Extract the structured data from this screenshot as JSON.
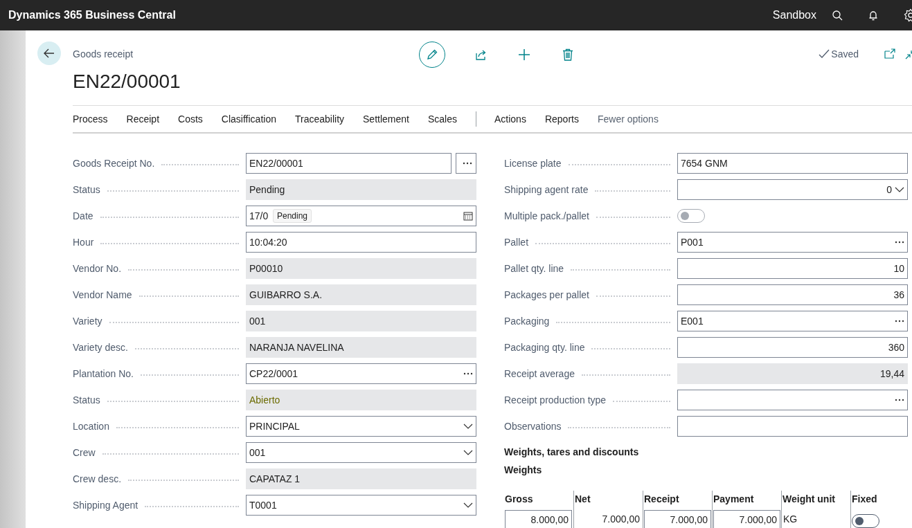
{
  "app_bar": {
    "title": "Dynamics 365 Business Central",
    "environment": "Sandbox"
  },
  "page": {
    "breadcrumb": "Goods receipt",
    "title": "EN22/00001",
    "save_status": "Saved"
  },
  "action_tab_groups": [
    {
      "tabs": [
        {
          "label": "Process",
          "kind": "tab"
        },
        {
          "label": "Receipt",
          "kind": "tab"
        },
        {
          "label": "Costs",
          "kind": "tab"
        },
        {
          "label": "Clasiffication",
          "kind": "tab"
        },
        {
          "label": "Traceability",
          "kind": "tab"
        },
        {
          "label": "Settlement",
          "kind": "tab"
        },
        {
          "label": "Scales",
          "kind": "tab"
        }
      ]
    },
    {
      "tabs": [
        {
          "label": "Actions",
          "kind": "tab"
        },
        {
          "label": "Reports",
          "kind": "tab"
        },
        {
          "label": "Fewer options",
          "kind": "toggle-link"
        }
      ]
    }
  ],
  "left_fields": [
    {
      "label": "Goods Receipt No.",
      "value": "EN22/00001",
      "kind": "assist",
      "emphasis": false
    },
    {
      "label": "Status",
      "value": "Pending",
      "kind": "readonly",
      "emphasis": false
    },
    {
      "label": "Date",
      "value": "17/0",
      "kind": "date",
      "tooltip": "Pending",
      "emphasis": false
    },
    {
      "label": "Hour",
      "value": "10:04:20",
      "kind": "text",
      "emphasis": false
    },
    {
      "label": "Vendor No.",
      "value": "P00010",
      "kind": "readonly",
      "emphasis": false
    },
    {
      "label": "Vendor Name",
      "value": "GUIBARRO S.A.",
      "kind": "readonly",
      "emphasis": false
    },
    {
      "label": "Variety",
      "value": "001",
      "kind": "readonly",
      "emphasis": false
    },
    {
      "label": "Variety desc.",
      "value": "NARANJA NAVELINA",
      "kind": "readonly",
      "emphasis": false
    },
    {
      "label": "Plantation No.",
      "value": "CP22/0001",
      "kind": "lookup",
      "emphasis": false
    },
    {
      "label": "Status",
      "value": "Abierto",
      "kind": "readonly",
      "emphasis": true
    },
    {
      "label": "Location",
      "value": "PRINCIPAL",
      "kind": "select",
      "emphasis": false
    },
    {
      "label": "Crew",
      "value": "001",
      "kind": "select",
      "emphasis": false
    },
    {
      "label": "Crew desc.",
      "value": "CAPATAZ 1",
      "kind": "readonly",
      "emphasis": false
    },
    {
      "label": "Shipping Agent",
      "value": "T0001",
      "kind": "select",
      "emphasis": false
    }
  ],
  "right_fields": [
    {
      "label": "License plate",
      "value": "7654 GNM",
      "kind": "text"
    },
    {
      "label": "Shipping agent rate",
      "value": "0",
      "kind": "number-select"
    },
    {
      "label": "Multiple pack./pallet",
      "kind": "toggle",
      "on": false
    },
    {
      "label": "Pallet",
      "value": "P001",
      "kind": "lookup"
    },
    {
      "label": "Pallet qty. line",
      "value": "10",
      "kind": "number"
    },
    {
      "label": "Packages per pallet",
      "value": "36",
      "kind": "number"
    },
    {
      "label": "Packaging",
      "value": "E001",
      "kind": "lookup"
    },
    {
      "label": "Packaging qty. line",
      "value": "360",
      "kind": "number"
    },
    {
      "label": "Receipt average",
      "value": "19,44",
      "kind": "number-readonly"
    },
    {
      "label": "Receipt production type",
      "kind": "lookup"
    },
    {
      "label": "Observations",
      "kind": "text"
    }
  ],
  "weights": {
    "heading": "Weights, tares and discounts",
    "subheading": "Weights",
    "columns": [
      "Gross",
      "Net",
      "Receipt",
      "Payment",
      "Weight unit",
      "Fixed"
    ],
    "rows": [
      {
        "cells": [
          {
            "kind": "input",
            "value": "8.000,00"
          },
          {
            "kind": "number",
            "value": "7.000,00"
          },
          {
            "kind": "input",
            "value": "7.000,00"
          },
          {
            "kind": "input",
            "value": "7.000,00"
          },
          {
            "kind": "text",
            "value": "KG"
          },
          {
            "kind": "toggle",
            "on": false
          }
        ]
      }
    ]
  }
}
